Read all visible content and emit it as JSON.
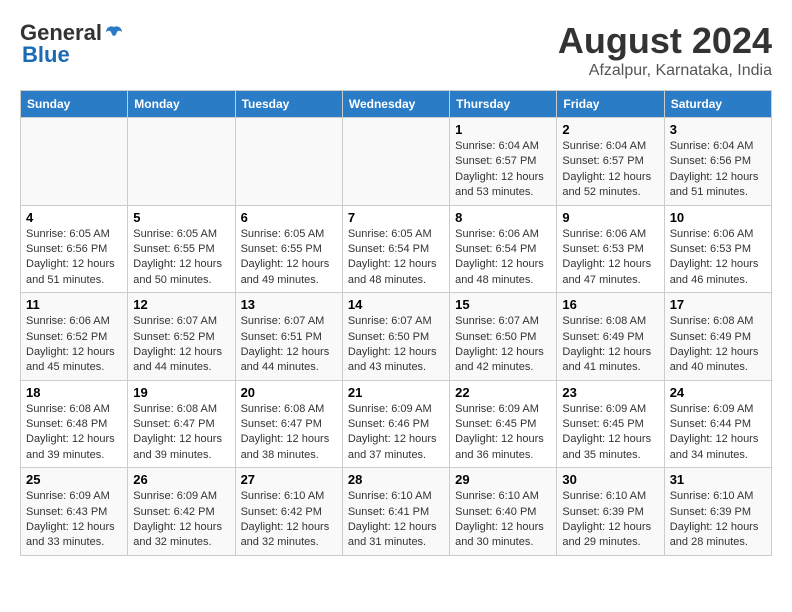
{
  "header": {
    "logo_general": "General",
    "logo_blue": "Blue",
    "title": "August 2024",
    "subtitle": "Afzalpur, Karnataka, India"
  },
  "weekdays": [
    "Sunday",
    "Monday",
    "Tuesday",
    "Wednesday",
    "Thursday",
    "Friday",
    "Saturday"
  ],
  "weeks": [
    [
      {
        "day": "",
        "info": ""
      },
      {
        "day": "",
        "info": ""
      },
      {
        "day": "",
        "info": ""
      },
      {
        "day": "",
        "info": ""
      },
      {
        "day": "1",
        "info": "Sunrise: 6:04 AM\nSunset: 6:57 PM\nDaylight: 12 hours and 53 minutes."
      },
      {
        "day": "2",
        "info": "Sunrise: 6:04 AM\nSunset: 6:57 PM\nDaylight: 12 hours and 52 minutes."
      },
      {
        "day": "3",
        "info": "Sunrise: 6:04 AM\nSunset: 6:56 PM\nDaylight: 12 hours and 51 minutes."
      }
    ],
    [
      {
        "day": "4",
        "info": "Sunrise: 6:05 AM\nSunset: 6:56 PM\nDaylight: 12 hours and 51 minutes."
      },
      {
        "day": "5",
        "info": "Sunrise: 6:05 AM\nSunset: 6:55 PM\nDaylight: 12 hours and 50 minutes."
      },
      {
        "day": "6",
        "info": "Sunrise: 6:05 AM\nSunset: 6:55 PM\nDaylight: 12 hours and 49 minutes."
      },
      {
        "day": "7",
        "info": "Sunrise: 6:05 AM\nSunset: 6:54 PM\nDaylight: 12 hours and 48 minutes."
      },
      {
        "day": "8",
        "info": "Sunrise: 6:06 AM\nSunset: 6:54 PM\nDaylight: 12 hours and 48 minutes."
      },
      {
        "day": "9",
        "info": "Sunrise: 6:06 AM\nSunset: 6:53 PM\nDaylight: 12 hours and 47 minutes."
      },
      {
        "day": "10",
        "info": "Sunrise: 6:06 AM\nSunset: 6:53 PM\nDaylight: 12 hours and 46 minutes."
      }
    ],
    [
      {
        "day": "11",
        "info": "Sunrise: 6:06 AM\nSunset: 6:52 PM\nDaylight: 12 hours and 45 minutes."
      },
      {
        "day": "12",
        "info": "Sunrise: 6:07 AM\nSunset: 6:52 PM\nDaylight: 12 hours and 44 minutes."
      },
      {
        "day": "13",
        "info": "Sunrise: 6:07 AM\nSunset: 6:51 PM\nDaylight: 12 hours and 44 minutes."
      },
      {
        "day": "14",
        "info": "Sunrise: 6:07 AM\nSunset: 6:50 PM\nDaylight: 12 hours and 43 minutes."
      },
      {
        "day": "15",
        "info": "Sunrise: 6:07 AM\nSunset: 6:50 PM\nDaylight: 12 hours and 42 minutes."
      },
      {
        "day": "16",
        "info": "Sunrise: 6:08 AM\nSunset: 6:49 PM\nDaylight: 12 hours and 41 minutes."
      },
      {
        "day": "17",
        "info": "Sunrise: 6:08 AM\nSunset: 6:49 PM\nDaylight: 12 hours and 40 minutes."
      }
    ],
    [
      {
        "day": "18",
        "info": "Sunrise: 6:08 AM\nSunset: 6:48 PM\nDaylight: 12 hours and 39 minutes."
      },
      {
        "day": "19",
        "info": "Sunrise: 6:08 AM\nSunset: 6:47 PM\nDaylight: 12 hours and 39 minutes."
      },
      {
        "day": "20",
        "info": "Sunrise: 6:08 AM\nSunset: 6:47 PM\nDaylight: 12 hours and 38 minutes."
      },
      {
        "day": "21",
        "info": "Sunrise: 6:09 AM\nSunset: 6:46 PM\nDaylight: 12 hours and 37 minutes."
      },
      {
        "day": "22",
        "info": "Sunrise: 6:09 AM\nSunset: 6:45 PM\nDaylight: 12 hours and 36 minutes."
      },
      {
        "day": "23",
        "info": "Sunrise: 6:09 AM\nSunset: 6:45 PM\nDaylight: 12 hours and 35 minutes."
      },
      {
        "day": "24",
        "info": "Sunrise: 6:09 AM\nSunset: 6:44 PM\nDaylight: 12 hours and 34 minutes."
      }
    ],
    [
      {
        "day": "25",
        "info": "Sunrise: 6:09 AM\nSunset: 6:43 PM\nDaylight: 12 hours and 33 minutes."
      },
      {
        "day": "26",
        "info": "Sunrise: 6:09 AM\nSunset: 6:42 PM\nDaylight: 12 hours and 32 minutes."
      },
      {
        "day": "27",
        "info": "Sunrise: 6:10 AM\nSunset: 6:42 PM\nDaylight: 12 hours and 32 minutes."
      },
      {
        "day": "28",
        "info": "Sunrise: 6:10 AM\nSunset: 6:41 PM\nDaylight: 12 hours and 31 minutes."
      },
      {
        "day": "29",
        "info": "Sunrise: 6:10 AM\nSunset: 6:40 PM\nDaylight: 12 hours and 30 minutes."
      },
      {
        "day": "30",
        "info": "Sunrise: 6:10 AM\nSunset: 6:39 PM\nDaylight: 12 hours and 29 minutes."
      },
      {
        "day": "31",
        "info": "Sunrise: 6:10 AM\nSunset: 6:39 PM\nDaylight: 12 hours and 28 minutes."
      }
    ]
  ]
}
